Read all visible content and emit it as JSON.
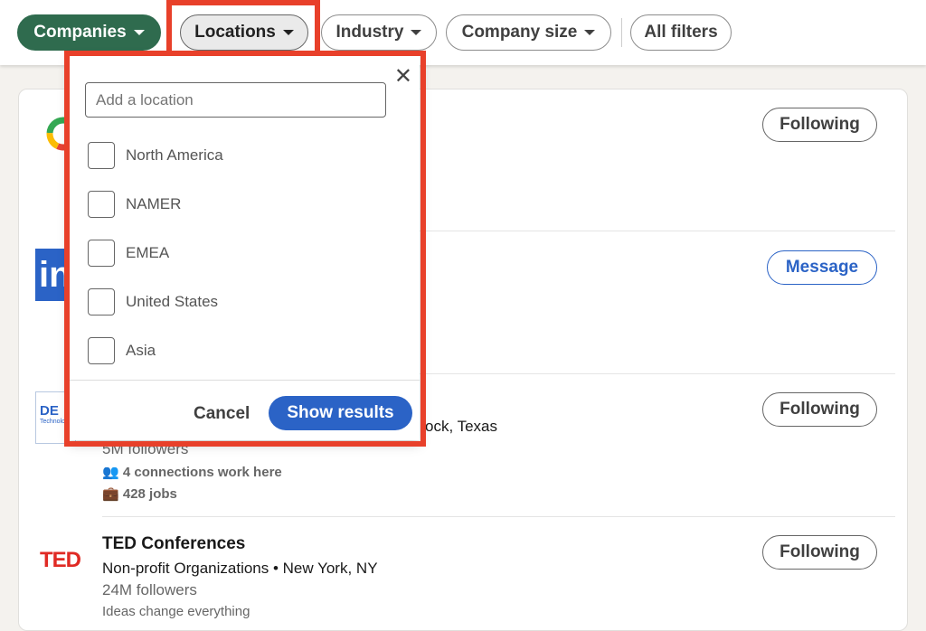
{
  "filters": {
    "companies": "Companies",
    "locations": "Locations",
    "industry": "Industry",
    "company_size": "Company size",
    "all_filters": "All filters"
  },
  "colors": {
    "accent_green": "#2f6b4e",
    "primary_blue": "#2b63c6",
    "highlight_red": "#e8402a"
  },
  "popup": {
    "placeholder": "Add a location",
    "options": [
      "North America",
      "NAMER",
      "EMEA",
      "United States",
      "Asia"
    ],
    "cancel": "Cancel",
    "show_results": "Show results",
    "close_icon": "close-icon"
  },
  "results": [
    {
      "logo": "google-logo",
      "action": "Following"
    },
    {
      "logo": "linkedin-logo",
      "action": "Message"
    },
    {
      "logo": "dell-technologies-logo",
      "logo_text": "Technologies",
      "location_partial": "ock, Texas",
      "followers": "5M followers",
      "connections": "4 connections work here",
      "jobs": "428 jobs",
      "action": "Following"
    },
    {
      "logo": "ted-logo",
      "logo_text": "TED",
      "name": "TED Conferences",
      "subtitle": "Non-profit Organizations • New York, NY",
      "followers": "24M followers",
      "tagline": "Ideas change everything",
      "action": "Following"
    }
  ]
}
